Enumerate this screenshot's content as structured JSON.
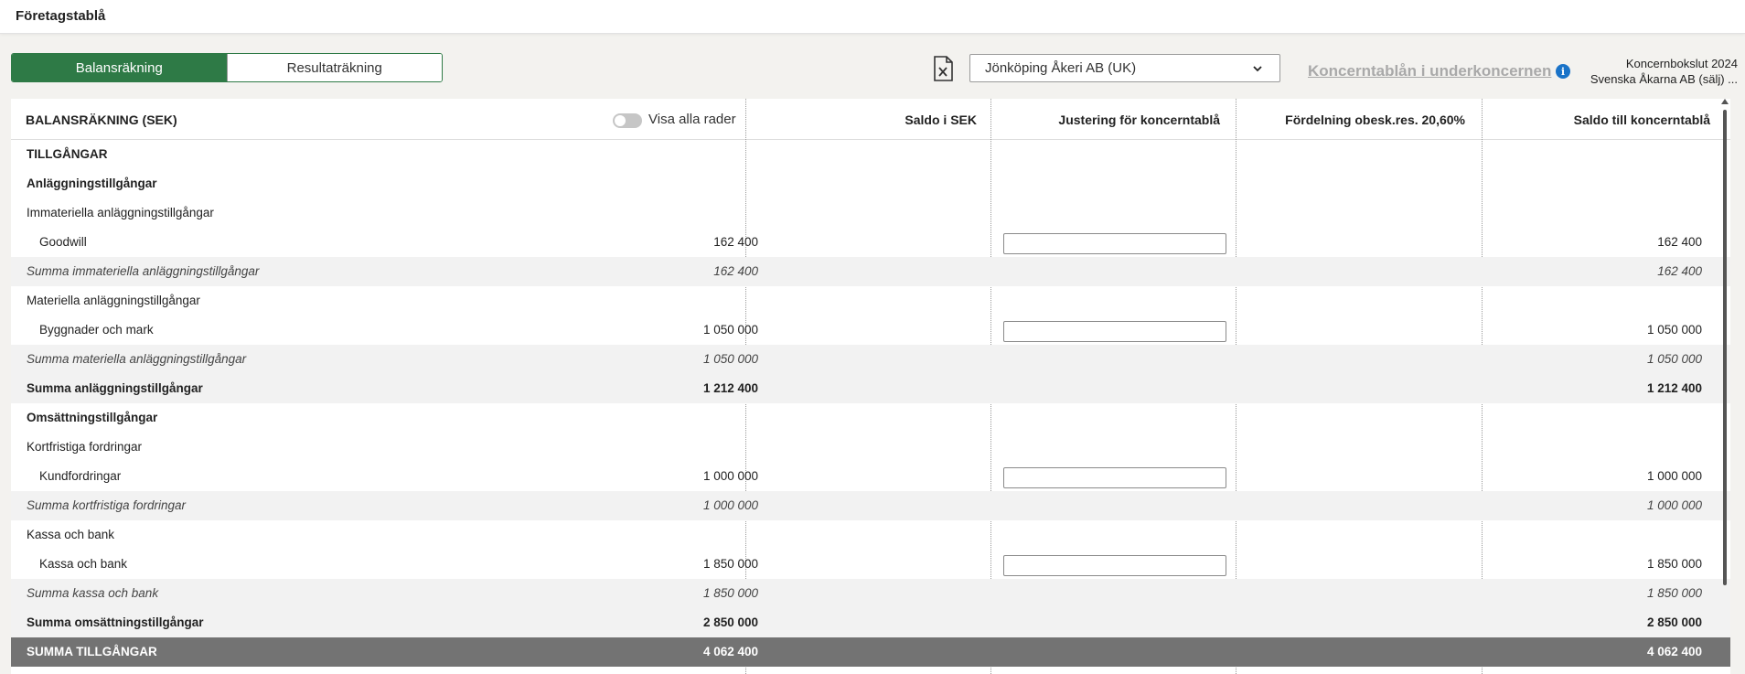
{
  "header": {
    "title": "Företagstablå"
  },
  "tabs": [
    {
      "label": "Balansräkning",
      "active": true
    },
    {
      "label": "Resultaträkning",
      "active": false
    }
  ],
  "icons": {
    "export": "excel-export-icon",
    "chevron": "chevron-down-icon",
    "info": "info-icon"
  },
  "company_select": {
    "value": "Jönköping Åkeri AB (UK)"
  },
  "sub_link": "Koncerntablån i underkoncernen",
  "info_text": "i",
  "right_info": {
    "line1": "Koncernbokslut 2024",
    "line2": "Svenska Åkarna AB (sälj) ..."
  },
  "table": {
    "headers": {
      "label": "BALANSRÄKNING (SEK)",
      "toggle_label": "Visa alla rader",
      "col1": "Saldo i SEK",
      "col2": "Justering för koncerntablå",
      "col3": "Fördelning obesk.res. 20,60%",
      "col4": "Saldo till koncerntablå"
    },
    "rows": [
      {
        "label": "TILLGÅNGAR",
        "style": "bold",
        "c1": "",
        "c4": "",
        "input": false
      },
      {
        "label": "Anläggningstillgångar",
        "style": "bold",
        "c1": "",
        "c4": "",
        "input": false
      },
      {
        "label": "Immateriella anläggningstillgångar",
        "style": "plain",
        "c1": "",
        "c4": "",
        "input": false
      },
      {
        "label": "Goodwill",
        "style": "indent",
        "c1": "162 400",
        "c4": "162 400",
        "input": true
      },
      {
        "label": "Summa immateriella anläggningstillgångar",
        "style": "italic",
        "c1": "162 400",
        "c4": "162 400",
        "input": false
      },
      {
        "label": "Materiella anläggningstillgångar",
        "style": "plain",
        "c1": "",
        "c4": "",
        "input": false
      },
      {
        "label": "Byggnader och mark",
        "style": "indent",
        "c1": "1 050 000",
        "c4": "1 050 000",
        "input": true
      },
      {
        "label": "Summa materiella anläggningstillgångar",
        "style": "italic",
        "c1": "1 050 000",
        "c4": "1 050 000",
        "input": false
      },
      {
        "label": "Summa anläggningstillgångar",
        "style": "boldshade",
        "c1": "1 212 400",
        "c4": "1 212 400",
        "input": false
      },
      {
        "label": "Omsättningstillgångar",
        "style": "bold",
        "c1": "",
        "c4": "",
        "input": false
      },
      {
        "label": "Kortfristiga fordringar",
        "style": "plain",
        "c1": "",
        "c4": "",
        "input": false
      },
      {
        "label": "Kundfordringar",
        "style": "indent",
        "c1": "1 000 000",
        "c4": "1 000 000",
        "input": true
      },
      {
        "label": "Summa kortfristiga fordringar",
        "style": "italic",
        "c1": "1 000 000",
        "c4": "1 000 000",
        "input": false
      },
      {
        "label": "Kassa och bank",
        "style": "plain",
        "c1": "",
        "c4": "",
        "input": false
      },
      {
        "label": "Kassa och bank",
        "style": "indent",
        "c1": "1 850 000",
        "c4": "1 850 000",
        "input": true
      },
      {
        "label": "Summa kassa och bank",
        "style": "italic",
        "c1": "1 850 000",
        "c4": "1 850 000",
        "input": false
      },
      {
        "label": "Summa omsättningstillgångar",
        "style": "boldshade",
        "c1": "2 850 000",
        "c4": "2 850 000",
        "input": false
      },
      {
        "label": "SUMMA TILLGÅNGAR",
        "style": "total",
        "c1": "4 062 400",
        "c4": "4 062 400",
        "input": false
      }
    ]
  }
}
